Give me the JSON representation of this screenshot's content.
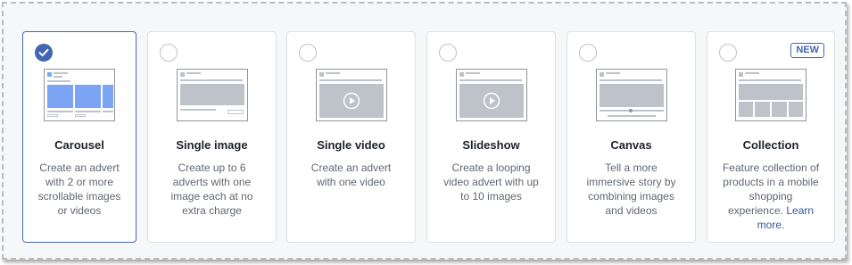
{
  "options": [
    {
      "title": "Carousel",
      "description": "Create an advert with 2 or more scrollable images or videos",
      "selected": true
    },
    {
      "title": "Single image",
      "description": "Create up to 6 adverts with one image each at no extra charge",
      "selected": false
    },
    {
      "title": "Single video",
      "description": "Create an advert with one video",
      "selected": false
    },
    {
      "title": "Slideshow",
      "description": "Create a looping video advert with up to 10 images",
      "selected": false
    },
    {
      "title": "Canvas",
      "description": "Tell a more immersive story by combining images and videos",
      "selected": false
    },
    {
      "title": "Collection",
      "description": "Feature collection of products in a mobile shopping experience.",
      "link_text": "Learn more",
      "link_suffix": ".",
      "badge": "NEW",
      "selected": false
    }
  ],
  "colors": {
    "accent": "#4267b2",
    "border": "#dddfe2",
    "placeholder": "#bec3c9",
    "highlight": "#7ba4f5"
  },
  "icons": {
    "selected": "checkmark-icon",
    "play": "play-icon"
  }
}
